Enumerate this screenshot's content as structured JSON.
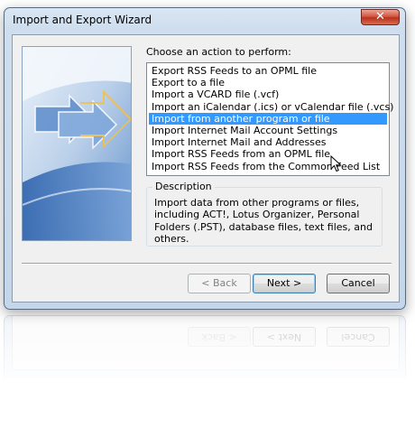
{
  "window": {
    "title": "Import and Export Wizard",
    "close_glyph": "✕"
  },
  "content": {
    "prompt": "Choose an action to perform:",
    "actions": [
      "Export RSS Feeds to an OPML file",
      "Export to a file",
      "Import a VCARD file (.vcf)",
      "Import an iCalendar (.ics) or vCalendar file (.vcs)",
      "Import from another program or file",
      "Import Internet Mail Account Settings",
      "Import Internet Mail and Addresses",
      "Import RSS Feeds from an OPML file",
      "Import RSS Feeds from the Common Feed List"
    ],
    "selected_index": 4,
    "description_label": "Description",
    "description_text": "Import data from other programs or files, including ACT!, Lotus Organizer, Personal Folders (.PST), database files, text files, and others."
  },
  "buttons": {
    "back": "< Back",
    "next": "Next >",
    "cancel": "Cancel",
    "back_enabled": false
  },
  "icons": {
    "close": "close-icon",
    "cursor": "arrow-pointer-icon",
    "art": "wizard-arrows-illustration"
  },
  "colors": {
    "selection": "#3399ff",
    "close_button": "#c8432c",
    "frame": "#c4d6ea"
  }
}
